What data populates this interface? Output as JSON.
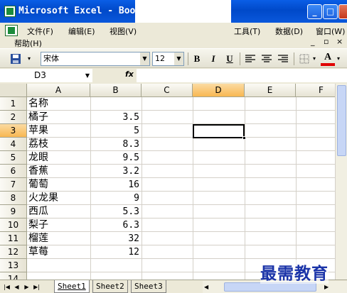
{
  "window": {
    "title": "Microsoft Excel - Boo",
    "controls": [
      "_",
      "□",
      "×"
    ]
  },
  "menu": {
    "items": [
      "文件(F)",
      "编辑(E)",
      "视图(V)",
      "工具(T)",
      "数据(D)",
      "窗口(W)",
      "帮助(H)"
    ],
    "doc_controls": [
      "_",
      "▫",
      "×"
    ]
  },
  "toolbar": {
    "font_name": "宋体",
    "font_size": "12",
    "bold": "B",
    "italic": "I",
    "underline": "U"
  },
  "formula_bar": {
    "name_box": "D3",
    "fx_label": "fx",
    "content": ""
  },
  "grid": {
    "columns": [
      "A",
      "B",
      "C",
      "D",
      "E",
      "F"
    ],
    "selected_column": "D",
    "row_numbers": [
      "1",
      "2",
      "3",
      "4",
      "5",
      "6",
      "7",
      "8",
      "9",
      "10",
      "11",
      "12",
      "13",
      "14"
    ],
    "selected_row": "3",
    "active_cell": "D3",
    "rows": [
      {
        "a": "名称",
        "b": ""
      },
      {
        "a": "橘子",
        "b": "3.5"
      },
      {
        "a": "苹果",
        "b": "5"
      },
      {
        "a": "荔枝",
        "b": "8.3"
      },
      {
        "a": "龙眼",
        "b": "9.5"
      },
      {
        "a": "香蕉",
        "b": "3.2"
      },
      {
        "a": "葡萄",
        "b": "16"
      },
      {
        "a": "火龙果",
        "b": "9"
      },
      {
        "a": "西瓜",
        "b": "5.3"
      },
      {
        "a": "梨子",
        "b": "6.3"
      },
      {
        "a": "榴莲",
        "b": "32"
      },
      {
        "a": "草莓",
        "b": "12"
      },
      {
        "a": "",
        "b": ""
      },
      {
        "a": "",
        "b": ""
      }
    ]
  },
  "sheets": {
    "tabs": [
      "Sheet1",
      "Sheet2",
      "Sheet3"
    ],
    "active": "Sheet1"
  },
  "watermark": "最需教育",
  "colors": {
    "titlebar": "#0a5ee6",
    "selected_header": "#f8b752",
    "watermark": "#1a33a8"
  }
}
